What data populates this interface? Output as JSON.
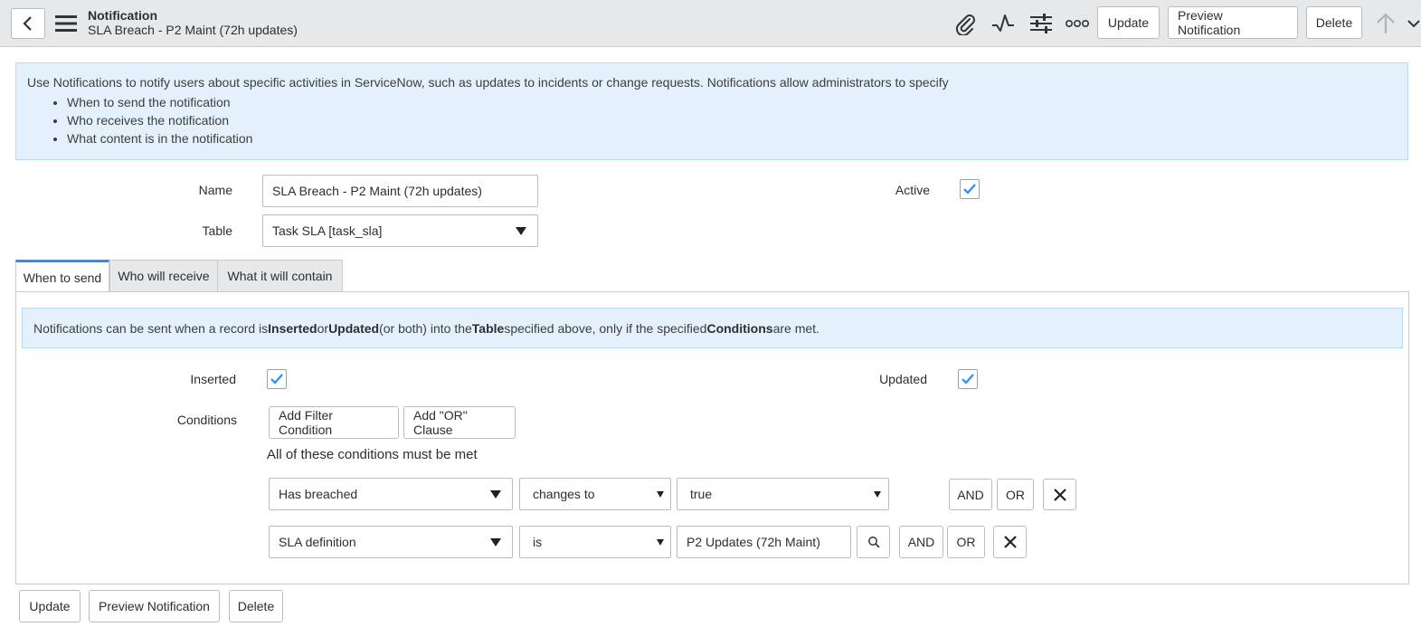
{
  "header": {
    "title": "Notification",
    "subtitle": "SLA Breach - P2 Maint (72h updates)",
    "icons": [
      "back-icon",
      "menu-icon",
      "attachment-icon",
      "activity-icon",
      "settings-icon",
      "more-icon",
      "up-arrow-icon",
      "chevron-down-icon"
    ],
    "update_label": "Update",
    "preview_label": "Preview Notification",
    "delete_label": "Delete"
  },
  "info": {
    "intro": "Use Notifications to notify users about specific activities in ServiceNow, such as updates to incidents or change requests. Notifications allow administrators to specify",
    "items": [
      "When to send the notification",
      "Who receives the notification",
      "What content is in the notification"
    ]
  },
  "form": {
    "name_label": "Name",
    "name_value": "SLA Breach - P2 Maint (72h updates)",
    "table_label": "Table",
    "table_value": "Task SLA [task_sla]",
    "active_label": "Active",
    "active_checked": true
  },
  "tabs": [
    {
      "label": "When to send",
      "active": true
    },
    {
      "label": "Who will receive",
      "active": false
    },
    {
      "label": "What it will contain",
      "active": false
    }
  ],
  "when": {
    "info_parts": [
      "Notifications can be sent when a record is ",
      "Inserted",
      " or ",
      "Updated",
      " (or both) into the ",
      "Table",
      " specified above, only if the specified ",
      "Conditions",
      " are met."
    ],
    "inserted_label": "Inserted",
    "inserted_checked": true,
    "updated_label": "Updated",
    "updated_checked": true,
    "conditions_label": "Conditions",
    "add_filter_label": "Add Filter Condition",
    "add_or_label": "Add \"OR\" Clause",
    "all_conditions_text": "All of these conditions must be met",
    "rows": [
      {
        "field": "Has breached",
        "operator": "changes to",
        "value": "true",
        "and_label": "AND",
        "or_label": "OR"
      },
      {
        "field": "SLA definition",
        "operator": "is",
        "value": "P2 Updates (72h Maint)",
        "and_label": "AND",
        "or_label": "OR"
      }
    ]
  },
  "footer": {
    "update_label": "Update",
    "preview_label": "Preview Notification",
    "delete_label": "Delete"
  },
  "colors": {
    "accent": "#278efc",
    "header_bg": "#e6e8ea",
    "info_bg": "#e4f1fc"
  }
}
